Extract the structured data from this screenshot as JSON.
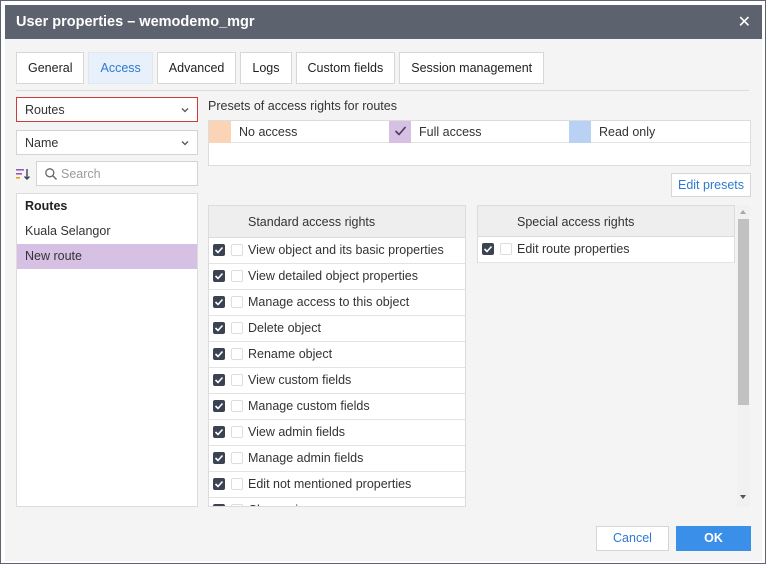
{
  "window": {
    "title": "User properties – wemodemo_mgr"
  },
  "tabs": [
    {
      "label": "General"
    },
    {
      "label": "Access"
    },
    {
      "label": "Advanced"
    },
    {
      "label": "Logs"
    },
    {
      "label": "Custom fields"
    },
    {
      "label": "Session management"
    }
  ],
  "active_tab": "Access",
  "left": {
    "type_select": "Routes",
    "sort_select": "Name",
    "search_placeholder": "Search",
    "list": [
      {
        "label": "Routes",
        "kind": "header"
      },
      {
        "label": "Kuala Selangor",
        "kind": "item"
      },
      {
        "label": "New route",
        "kind": "selected"
      }
    ]
  },
  "presets": {
    "label": "Presets of access rights for routes",
    "items": [
      {
        "label": "No access",
        "color": "#fbd3b7"
      },
      {
        "label": "Full access",
        "color": "#d6c0e4",
        "checked": true
      },
      {
        "label": "Read only",
        "color": "#b9d2f3"
      }
    ],
    "edit_label": "Edit presets"
  },
  "standard": {
    "header": "Standard access rights",
    "rights": [
      "View object and its basic properties",
      "View detailed object properties",
      "Manage access to this object",
      "Delete object",
      "Rename object",
      "View custom fields",
      "Manage custom fields",
      "View admin fields",
      "Manage admin fields",
      "Edit not mentioned properties",
      "Change icon"
    ]
  },
  "special": {
    "header": "Special access rights",
    "rights": [
      "Edit route properties"
    ]
  },
  "buttons": {
    "cancel": "Cancel",
    "ok": "OK"
  },
  "colors": {
    "accent": "#3a8fe8",
    "titlebar": "#5d636e",
    "selected_row": "#d6c0e4",
    "highlight_border": "#cf3a3a"
  },
  "icons": [
    "close-icon",
    "chevron-down-icon",
    "sort-icon",
    "search-icon",
    "checkbox-checked-icon"
  ]
}
